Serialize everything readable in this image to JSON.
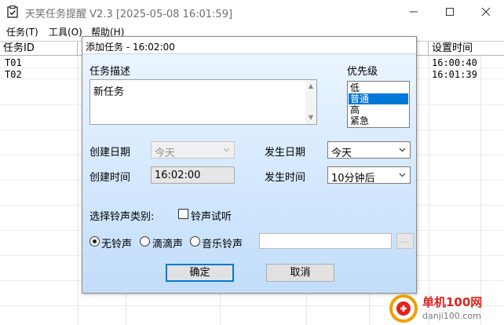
{
  "window": {
    "title": "天笑任务提醒 V2.3 [2025-05-08 16:01:59]"
  },
  "menu": {
    "items": [
      "任务(T)",
      "工具(O)",
      "帮助(H)"
    ]
  },
  "grid": {
    "headers": [
      "任务ID",
      "设置时间"
    ],
    "rows": [
      {
        "id": "T01",
        "time": "16:00:40"
      },
      {
        "id": "T02",
        "time": "16:01:39"
      }
    ]
  },
  "dialog": {
    "title": "添加任务 - 16:02:00",
    "desc_label": "任务描述",
    "desc_value": "新任务",
    "priority_label": "优先级",
    "priority_options": [
      "低",
      "普通",
      "高",
      "紧急"
    ],
    "priority_selected": "普通",
    "create_date_label": "创建日期",
    "create_date_value": "今天",
    "create_time_label": "创建时间",
    "create_time_value": "16:02:00",
    "occur_date_label": "发生日期",
    "occur_date_value": "今天",
    "occur_time_label": "发生时间",
    "occur_time_value": "10分钟后",
    "ringtone_type_label": "选择铃声类别:",
    "ringtone_test_label": "铃声试听",
    "ringtone_options": [
      "无铃声",
      "滴滴声",
      "音乐铃声"
    ],
    "ringtone_selected": "无铃声",
    "browse_label": "...",
    "ok_label": "确定",
    "cancel_label": "取消"
  },
  "watermark": {
    "name": "单机100网",
    "url": "danji100.com"
  },
  "colors": {
    "selection": "#0078d7",
    "dialog_gradient_top": "#eef6ff",
    "dialog_gradient_bottom": "#c2ddfa",
    "watermark_red": "#e2221b"
  }
}
